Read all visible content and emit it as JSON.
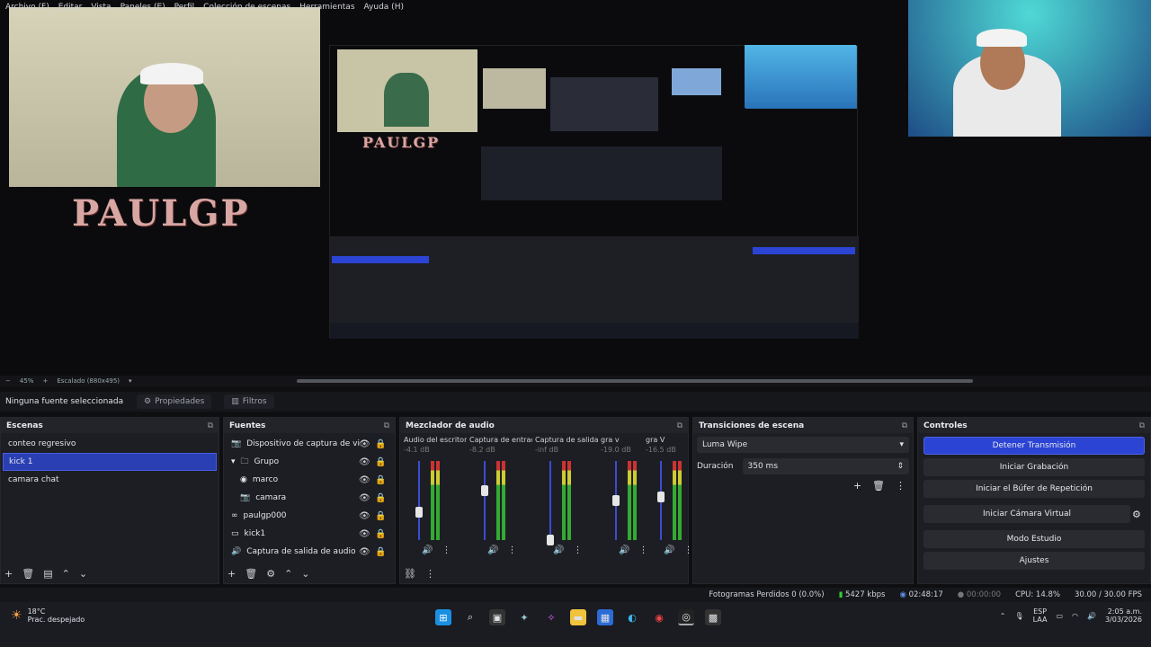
{
  "menu": [
    "Archivo (F)",
    "Editar",
    "Vista",
    "Paneles (E)",
    "Perfil",
    "Colección de escenas",
    "Herramientas",
    "Ayuda (H)"
  ],
  "preview": {
    "overlay_text": "PAULGP",
    "nested_text": "PAULGP"
  },
  "scale": {
    "zoom": "45%",
    "label": "Escalado (880x495)"
  },
  "source_toolbar": {
    "no_source": "Ninguna fuente seleccionada",
    "properties": "Propiedades",
    "filters": "Filtros"
  },
  "scenes": {
    "title": "Escenas",
    "items": [
      {
        "label": "conteo regresivo"
      },
      {
        "label": "kick 1"
      },
      {
        "label": "camara chat"
      }
    ]
  },
  "sources": {
    "title": "Fuentes",
    "items": [
      {
        "label": "Dispositivo de captura de video",
        "icon": "camera-icon"
      },
      {
        "label": "Grupo",
        "icon": "folder-icon"
      },
      {
        "label": "marco",
        "icon": "image-icon"
      },
      {
        "label": "camara",
        "icon": "camera-icon"
      },
      {
        "label": "paulgp000",
        "icon": "link-icon"
      },
      {
        "label": "kick1",
        "icon": "monitor-icon"
      },
      {
        "label": "Captura de salida de audio",
        "icon": "speaker-icon"
      }
    ]
  },
  "mixer": {
    "title": "Mezclador de audio",
    "channels": [
      {
        "name": "Audio del escritorio",
        "db": "-4.1 dB",
        "level": 0.35
      },
      {
        "name": "Captura de entrada",
        "db": "-8.2 dB",
        "level": 0.62
      },
      {
        "name": "Captura de salida de",
        "db": "-inf dB",
        "level": 0.0
      },
      {
        "name": "gra v",
        "db": "-19.0 dB",
        "level": 0.5
      },
      {
        "name": "gra V",
        "db": "-16.5 dB",
        "level": 0.55
      }
    ]
  },
  "transitions": {
    "title": "Transiciones de escena",
    "selected": "Luma Wipe",
    "duration_label": "Duración",
    "duration_value": "350 ms"
  },
  "controls": {
    "title": "Controles",
    "buttons": [
      "Detener Transmisión",
      "Iniciar Grabación",
      "Iniciar el Búfer de Repetición",
      "Iniciar Cámara Virtual",
      "Modo Estudio",
      "Ajustes"
    ]
  },
  "status": {
    "dropped": "Fotogramas Perdidos 0 (0.0%)",
    "bitrate": "5427 kbps",
    "stream_time": "02:48:17",
    "rec_time": "00:00:00",
    "cpu": "CPU: 14.8%",
    "fps": "30.00 / 30.00 FPS"
  },
  "taskbar": {
    "temp": "18°C",
    "weather": "Prac. despejado",
    "lang": "ESP",
    "lang2": "LAA",
    "time": "2:05 a.m.",
    "date": "3/03/2026"
  },
  "colors": {
    "accent": "#2b44d4",
    "panel": "#1d1e23"
  }
}
